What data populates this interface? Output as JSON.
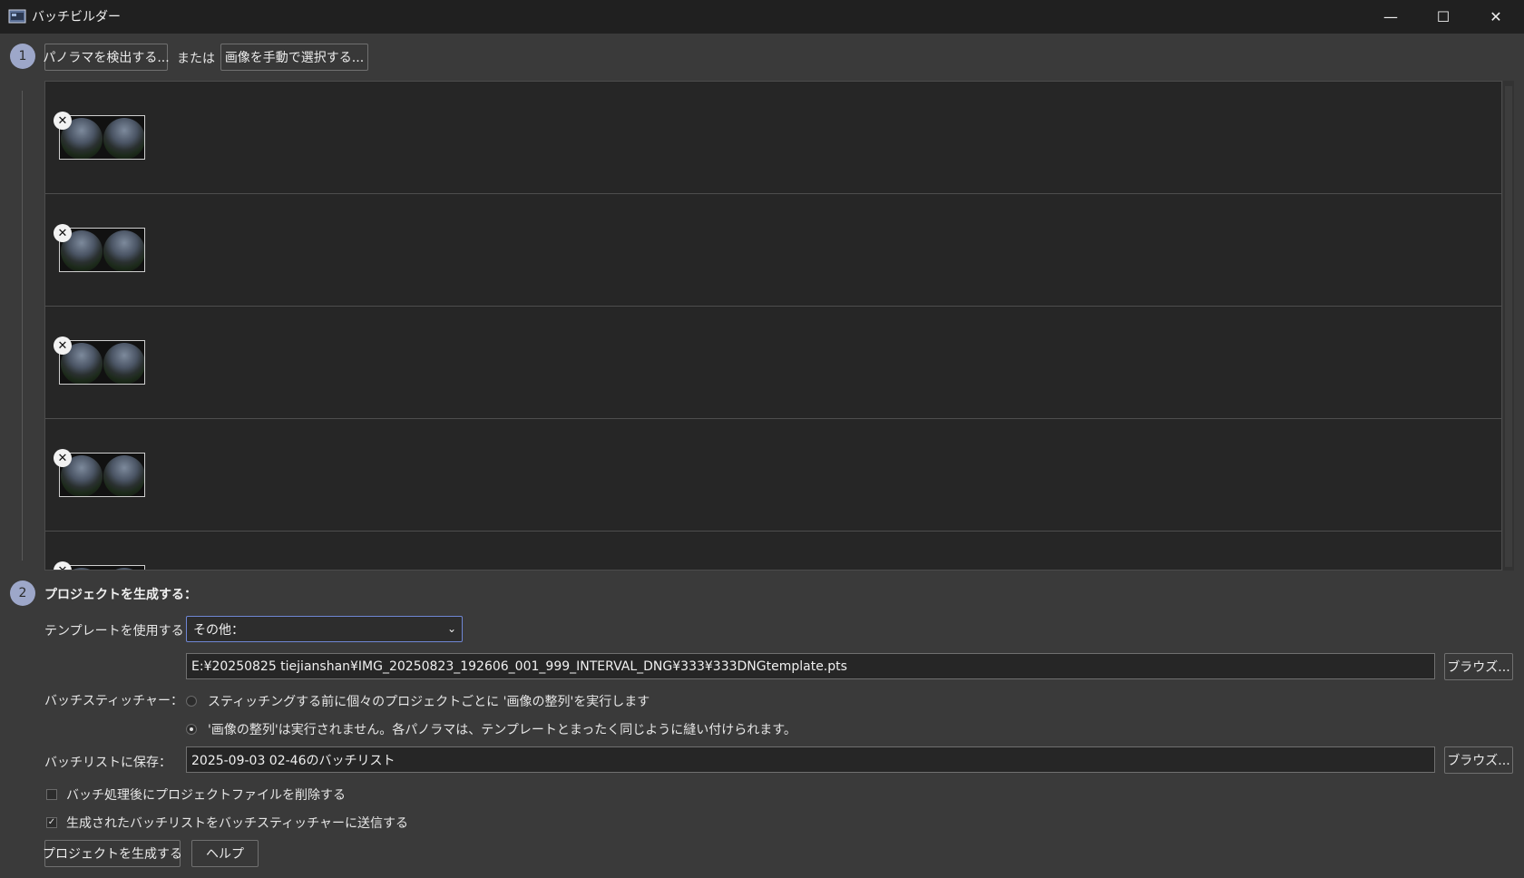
{
  "window": {
    "title": "バッチビルダー",
    "minimize_icon": "minimize-icon",
    "maximize_icon": "maximize-icon",
    "close_icon": "close-icon"
  },
  "step1": {
    "number": "1",
    "detect_button": "パノラマを検出する...",
    "or_text": "または",
    "manual_button": "画像を手動で選択する..."
  },
  "panoramas": {
    "remove_icon_glyph": "✕",
    "count_visible": 5
  },
  "step2": {
    "number": "2",
    "title": "プロジェクトを生成する：",
    "template_label": "テンプレートを使用する：",
    "template_selected": "その他：",
    "template_path": "E:¥20250825 tiejianshan¥IMG_20250823_192606_001_999_INTERVAL_DNG¥333¥333DNGtemplate.pts",
    "browse_label": "ブラウズ...",
    "stitcher_label": "バッチスティッチャー：",
    "radio_option1": "スティッチングする前に個々のプロジェクトごとに '画像の整列'を実行します",
    "radio_option2": "'画像の整列'は実行されません。各パノラマは、テンプレートとまったく同じように縫い付けられます。",
    "radio_selected": 2,
    "save_label": "バッチリストに保存：",
    "save_value": "2025-09-03 02-46のバッチリスト",
    "check_delete": "バッチ処理後にプロジェクトファイルを削除する",
    "check_delete_checked": false,
    "check_send": "生成されたバッチリストをバッチスティッチャーに送信する",
    "check_send_checked": true,
    "create_button": "プロジェクトを生成する",
    "help_button": "ヘルプ"
  },
  "colors": {
    "background": "#3a3a3a",
    "titlebar": "#202020",
    "list_background": "#262626",
    "accent_border": "#6f86d4",
    "step_circle": "#9da7c9"
  }
}
